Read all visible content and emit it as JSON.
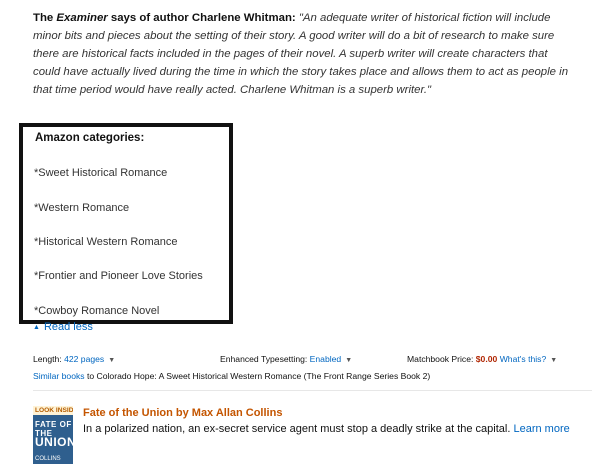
{
  "review": {
    "prefix": "The ",
    "publication": "Examiner",
    "lead_rest": " says of author Charlene Whitman: ",
    "quote": "\"An adequate writer of historical fiction will include minor bits and pieces about the setting of their story. A good writer will do a bit of research to make sure there are historical facts included in the pages of their novel. A superb writer will create characters that could have actually lived during the time in which the story takes place and allows them to act as people in that time period would have really acted. Charlene Whitman is a superb writer.\""
  },
  "categories": {
    "heading": "Amazon categories:",
    "items": [
      "*Sweet Historical Romance",
      "*Western Romance",
      "*Historical Western Romance",
      "*Frontier and Pioneer Love Stories",
      "*Cowboy Romance Novel"
    ]
  },
  "read_less": "Read less",
  "details": {
    "length_label": "Length: ",
    "length_value": "422 pages",
    "typesetting_label": "Enhanced Typesetting: ",
    "typesetting_value": "Enabled",
    "matchbook_label": "Matchbook Price: ",
    "matchbook_value": "$0.00",
    "whats_this": "What's this?"
  },
  "similar": {
    "link": "Similar books",
    "rest": " to Colorado Hope: A Sweet Historical Western Romance (The Front Range Series Book 2)"
  },
  "recommendation": {
    "badge": "LOOK INSIDE!",
    "cover_line1": "FATE",
    "cover_line2": "OF THE",
    "cover_line3": "UNION",
    "cover_author": "COLLINS",
    "title": "Fate of the Union by Max Allan Collins",
    "description": "In a polarized nation, an ex-secret service agent must stop a deadly strike at the capital.",
    "learn_more": "Learn more"
  },
  "colors": {
    "link": "#0066c0",
    "price": "#b12704",
    "rec_title": "#c45500"
  },
  "icons": {
    "caret_up": "caret-up-icon",
    "caret_down": "caret-down-icon"
  }
}
